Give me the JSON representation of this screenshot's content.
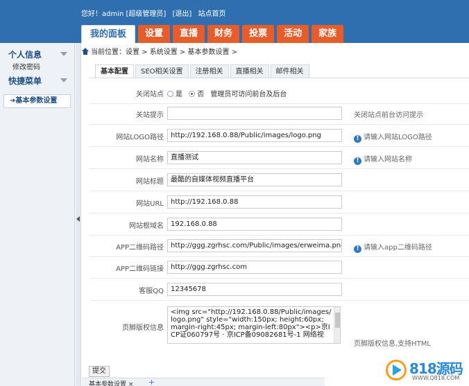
{
  "header": {
    "greeting": "您好！admin [超级管理员]",
    "logout": "[退出]",
    "site_home": "站点首页"
  },
  "nav": [
    "我的面板",
    "设置",
    "直播",
    "财务",
    "投票",
    "活动",
    "家族"
  ],
  "sidebar": {
    "section1": "个人信息",
    "item1": "修改密码",
    "section2": "快捷菜单",
    "item2": "➜基本参数设置"
  },
  "breadcrumb": "当前位置：设置 > 系统设置 > 基本参数设置 >",
  "tabs": [
    "基本配置",
    "SEO相关设置",
    "注册相关",
    "直播相关",
    "邮件相关"
  ],
  "form": {
    "close_site": {
      "label": "关闭站点",
      "opt_yes": "是",
      "opt_no": "否",
      "note": "管理员可访问前台及后台"
    },
    "close_tip": {
      "label": "关站提示",
      "value": "",
      "hint": "关闭站点前台访问提示"
    },
    "logo_path": {
      "label": "网站LOGO路径",
      "value": "http://192.168.0.88/Public/images/logo.png",
      "hint": "请输入网站LOGO路径"
    },
    "site_name": {
      "label": "网站名称",
      "value": "直播测试",
      "hint": "请输入网站名称"
    },
    "site_title": {
      "label": "网站标题",
      "value": "最酷的自媒体视频直播平台"
    },
    "site_url": {
      "label": "网站URL",
      "value": "http://192.168.0.88"
    },
    "root_domain": {
      "label": "网站根域名",
      "value": "192.168.0.88"
    },
    "qr_path": {
      "label": "APP二维码路径",
      "value": "http://ggg.zgrhsc.com/Public/images/erweima.png",
      "hint": "请输入app二维码路径"
    },
    "qr_link": {
      "label": "APP二维码链接",
      "value": "http://ggg.zgrhsc.com"
    },
    "service_qq": {
      "label": "客服QQ",
      "value": "12345678"
    },
    "footer": {
      "label": "页脚版权信息",
      "value": "<img src=\"http://192.168.0.88/Public/images/logo.png\" style=\"width:150px; height:60px; margin-right:45px; margin-left:80px\"><p>京ICP证060797号 · 京ICP备09082681号-1 网络视",
      "hint": "页脚版权信息,支持HTML"
    }
  },
  "submit": "提交",
  "bottom_tab": "基本参数设置 ×",
  "bottom_plus": "+",
  "watermark": {
    "main": "818源码",
    "sub": "WWW.Q818.COM"
  }
}
